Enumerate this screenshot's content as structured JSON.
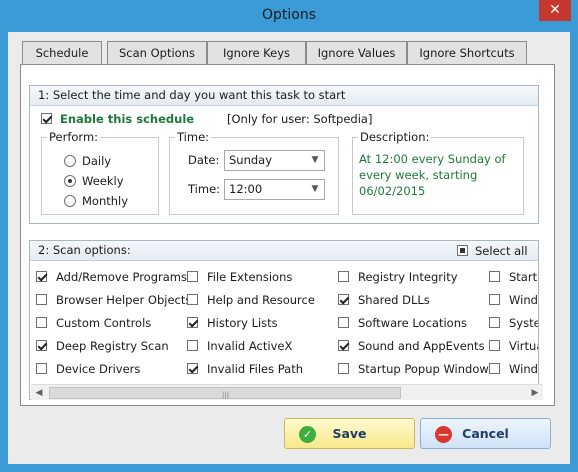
{
  "window": {
    "title": "Options",
    "close_glyph": "✕"
  },
  "tabs": [
    {
      "label": "Schedule"
    },
    {
      "label": "Scan Options"
    },
    {
      "label": "Ignore Keys"
    },
    {
      "label": "Ignore Values"
    },
    {
      "label": "Ignore Shortcuts"
    }
  ],
  "schedule": {
    "header": "1: Select the time and day you want this task to start",
    "enable_label": "Enable this schedule",
    "user_note": "[Only for user: Softpedia]",
    "perform": {
      "title": "Perform:",
      "options": [
        {
          "label": "Daily"
        },
        {
          "label": "Weekly"
        },
        {
          "label": "Monthly"
        }
      ]
    },
    "time": {
      "title": "Time:",
      "date_label": "Date:",
      "date_value": "Sunday",
      "time_label": "Time:",
      "time_value": "12:00"
    },
    "description": {
      "title": "Description:",
      "text": "At 12:00 every Sunday of every week, starting 06/02/2015"
    }
  },
  "scan": {
    "header": "2: Scan options:",
    "select_all": "Select all",
    "items": [
      {
        "label": "Add/Remove Programs"
      },
      {
        "label": "File Extensions"
      },
      {
        "label": "Registry Integrity"
      },
      {
        "label": "Startu"
      },
      {
        "label": "Browser Helper Objects"
      },
      {
        "label": "Help and Resource"
      },
      {
        "label": "Shared DLLs"
      },
      {
        "label": "Windo"
      },
      {
        "label": "Custom Controls"
      },
      {
        "label": "History Lists"
      },
      {
        "label": "Software Locations"
      },
      {
        "label": "Syste"
      },
      {
        "label": "Deep Registry Scan"
      },
      {
        "label": "Invalid ActiveX"
      },
      {
        "label": "Sound and AppEvents"
      },
      {
        "label": "Virtua"
      },
      {
        "label": "Device Drivers"
      },
      {
        "label": "Invalid Files Path"
      },
      {
        "label": "Startup Popup Window"
      },
      {
        "label": "Windo"
      }
    ]
  },
  "buttons": {
    "save": "Save",
    "cancel": "Cancel"
  }
}
